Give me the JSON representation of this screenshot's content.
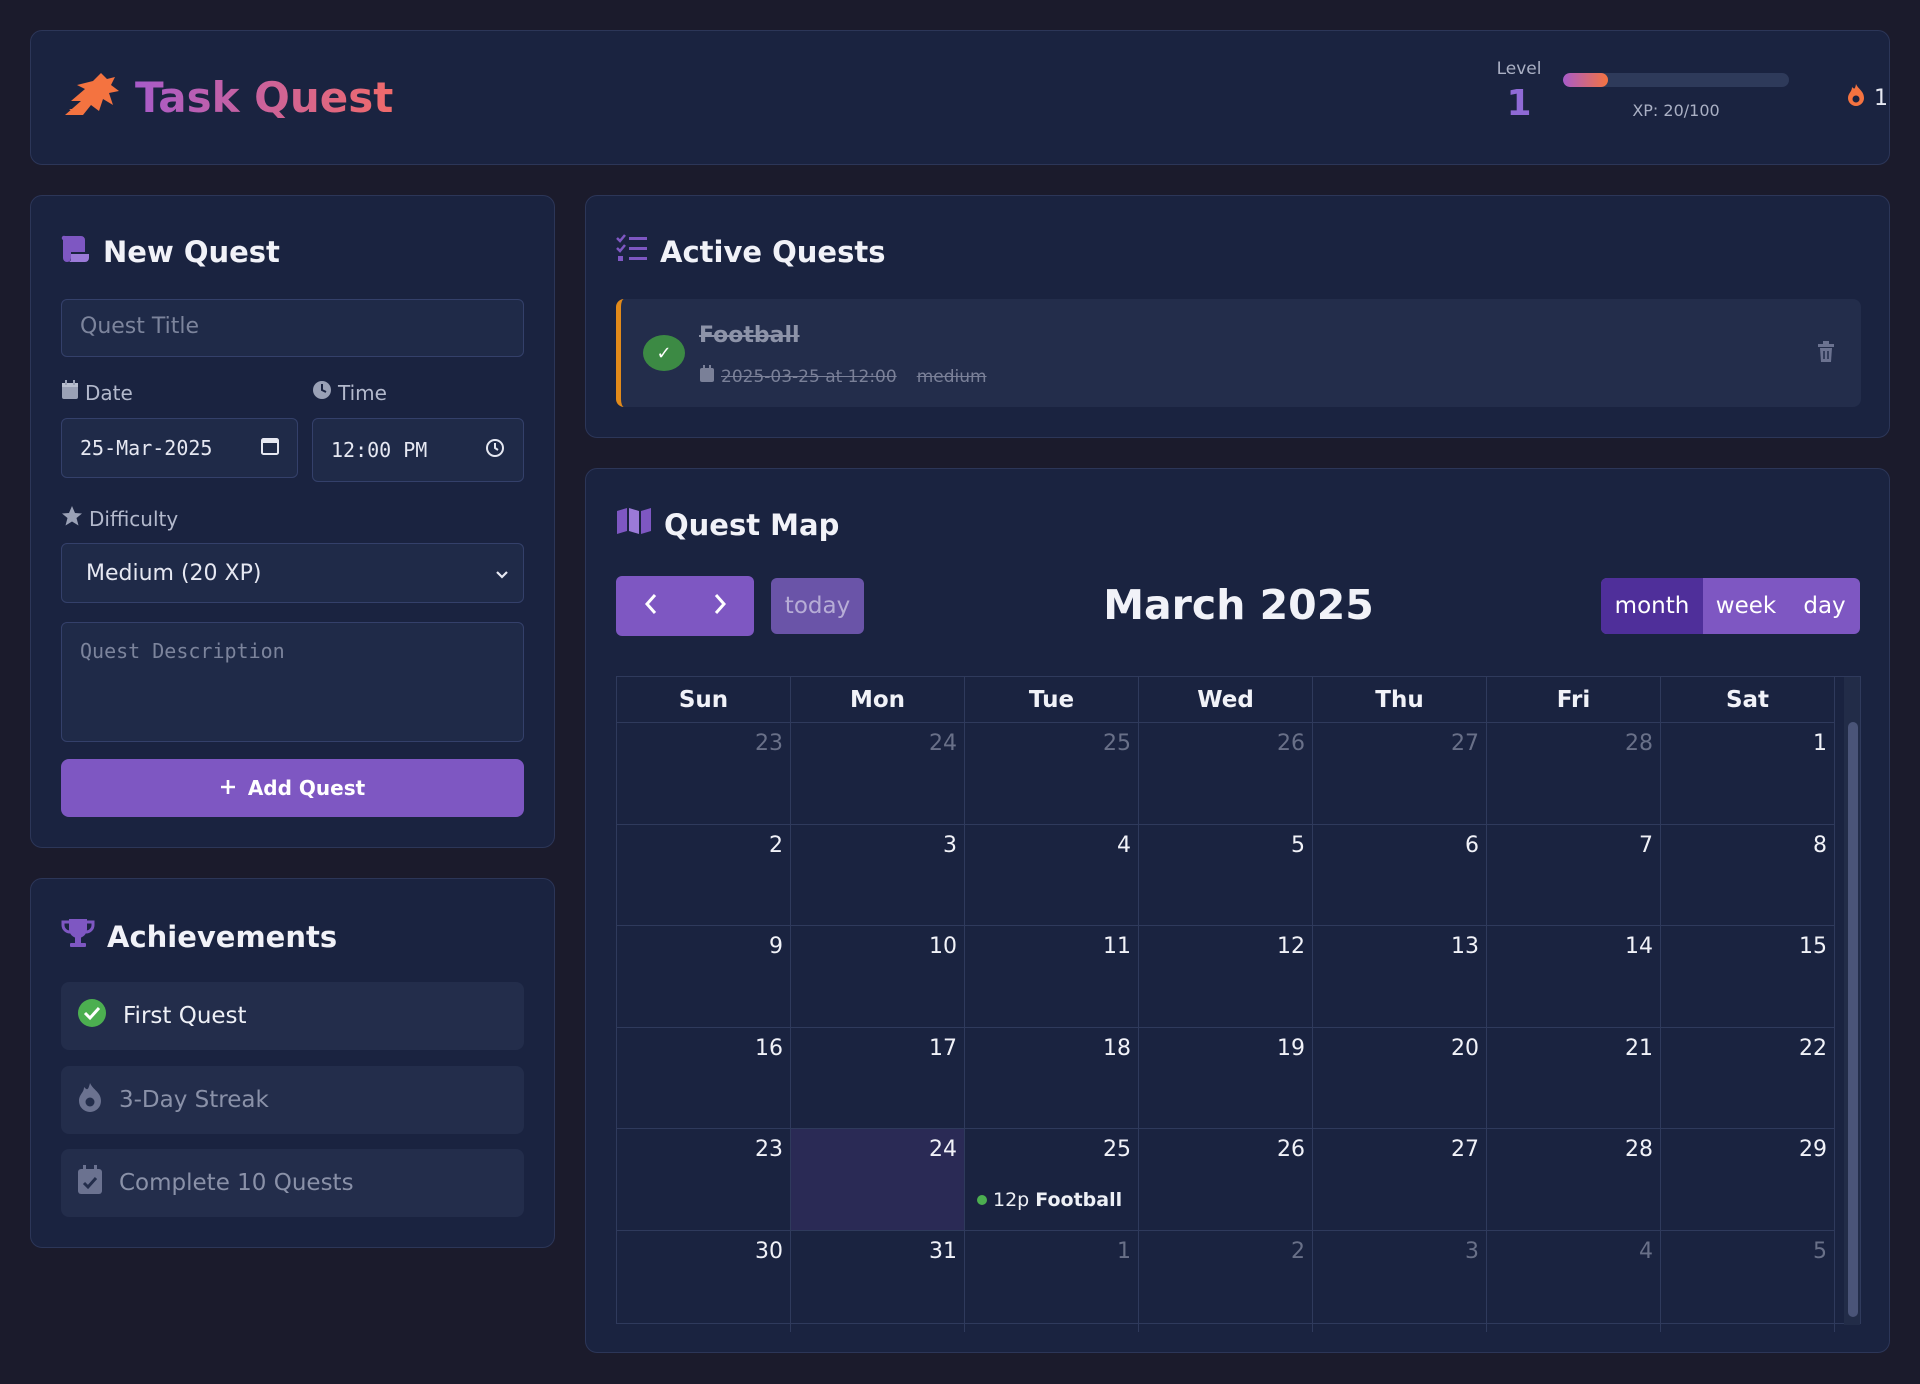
{
  "header": {
    "title": "Task Quest",
    "level_label": "Level",
    "level_value": "1",
    "xp_text": "XP: 20/100",
    "xp_progress": 0.2,
    "streak_count": "1"
  },
  "new_quest": {
    "title": "New Quest",
    "title_placeholder": "Quest Title",
    "date_label": "Date",
    "date_value": "25-Mar-2025",
    "time_label": "Time",
    "time_value": "12:00 PM",
    "difficulty_label": "Difficulty",
    "difficulty_value": "Medium (20 XP)",
    "description_placeholder": "Quest Description",
    "add_button": "Add Quest"
  },
  "achievements": {
    "title": "Achievements",
    "items": [
      {
        "label": "First Quest",
        "unlocked": true
      },
      {
        "label": "3-Day Streak",
        "unlocked": false
      },
      {
        "label": "Complete 10 Quests",
        "unlocked": false
      }
    ]
  },
  "active_quests": {
    "title": "Active Quests",
    "items": [
      {
        "title": "Football",
        "date": "2025-03-25 at 12:00",
        "difficulty": "medium",
        "completed": true
      }
    ]
  },
  "quest_map": {
    "title": "Quest Map",
    "today_label": "today",
    "month_title": "March 2025",
    "views": [
      "month",
      "week",
      "day"
    ],
    "active_view": "month",
    "weekdays": [
      "Sun",
      "Mon",
      "Tue",
      "Wed",
      "Thu",
      "Fri",
      "Sat"
    ],
    "weeks": [
      [
        "23",
        "24",
        "25",
        "26",
        "27",
        "28",
        "1"
      ],
      [
        "2",
        "3",
        "4",
        "5",
        "6",
        "7",
        "8"
      ],
      [
        "9",
        "10",
        "11",
        "12",
        "13",
        "14",
        "15"
      ],
      [
        "16",
        "17",
        "18",
        "19",
        "20",
        "21",
        "22"
      ],
      [
        "23",
        "24",
        "25",
        "26",
        "27",
        "28",
        "29"
      ],
      [
        "30",
        "31",
        "1",
        "2",
        "3",
        "4",
        "5"
      ]
    ],
    "today_cell": [
      4,
      1
    ],
    "event": {
      "week": 4,
      "day": 2,
      "time": "12p",
      "title": "Football"
    }
  },
  "colors": {
    "accent": "#7e57c2",
    "event_dot": "#4caf50",
    "quest_border": "#e28a1a",
    "streak": "#f47340"
  }
}
